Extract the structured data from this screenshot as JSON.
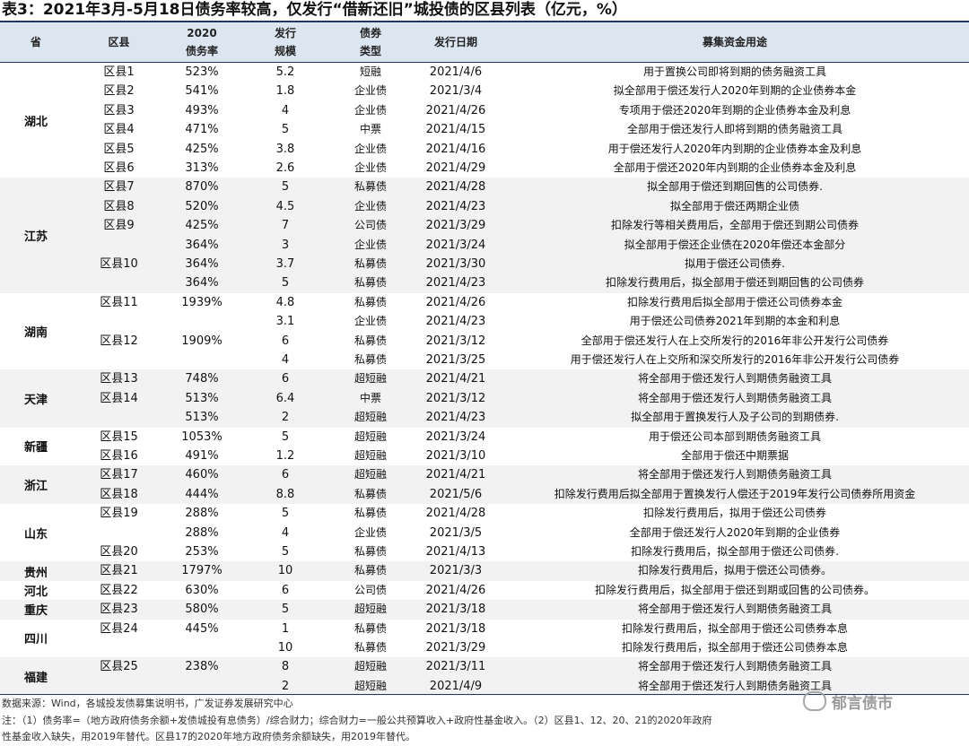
{
  "title": "表3：2021年3月-5月18日债务率较高，仅发行“借新还旧”城投债的区县列表（亿元，%）",
  "headers": {
    "province": "省",
    "county": "区县",
    "rate_1": "2020",
    "rate_2": "债务率",
    "scale_1": "发行",
    "scale_2": "规模",
    "type_1": "债券",
    "type_2": "类型",
    "date": "发行日期",
    "use": "募集资金用途"
  },
  "groups": [
    {
      "province": "湖北",
      "shade": false,
      "rows": [
        {
          "county": "区县1",
          "rate": "523%",
          "scale": "5.2",
          "type": "短融",
          "date": "2021/4/6",
          "use": "用于置换公司即将到期的债务融资工具"
        },
        {
          "county": "区县2",
          "rate": "541%",
          "scale": "1.8",
          "type": "企业债",
          "date": "2021/3/4",
          "use": "拟全部用于偿还发行人2020年到期的企业债券本金"
        },
        {
          "county": "区县3",
          "rate": "493%",
          "scale": "4",
          "type": "企业债",
          "date": "2021/4/26",
          "use": "专项用于偿还2020年到期的企业债券本金及利息"
        },
        {
          "county": "区县4",
          "rate": "471%",
          "scale": "5",
          "type": "中票",
          "date": "2021/4/15",
          "use": "全部用于偿还发行人即将到期的债务融资工具"
        },
        {
          "county": "区县5",
          "rate": "425%",
          "scale": "3.8",
          "type": "企业债",
          "date": "2021/4/16",
          "use": "用于偿还发行人2020年内到期的企业债券本金及利息"
        },
        {
          "county": "区县6",
          "rate": "313%",
          "scale": "2.6",
          "type": "企业债",
          "date": "2021/4/29",
          "use": "全部用于偿还2020年内到期的企业债券本金及利息"
        }
      ]
    },
    {
      "province": "江苏",
      "shade": true,
      "rows": [
        {
          "county": "区县7",
          "rate": "870%",
          "scale": "5",
          "type": "私募债",
          "date": "2021/4/28",
          "use": "拟全部用于偿还到期回售的公司债券."
        },
        {
          "county": "区县8",
          "rate": "520%",
          "scale": "4.5",
          "type": "企业债",
          "date": "2021/4/23",
          "use": "拟全部用于偿还两期企业债"
        },
        {
          "county": "区县9",
          "rate": "425%",
          "scale": "7",
          "type": "公司债",
          "date": "2021/3/29",
          "use": "扣除发行等相关费用后，全部用于偿还到期公司债券"
        },
        {
          "county": "",
          "rate": "364%",
          "scale": "3",
          "type": "企业债",
          "date": "2021/3/24",
          "use": "拟全部用于偿还企业债在2020年偿还本金部分"
        },
        {
          "county": "区县10",
          "rate": "364%",
          "scale": "3.7",
          "type": "私募债",
          "date": "2021/3/30",
          "use": "拟用于偿还公司债券."
        },
        {
          "county": "",
          "rate": "364%",
          "scale": "5",
          "type": "私募债",
          "date": "2021/4/23",
          "use": "扣除发行费用后，拟全部用于偿还到期回售的公司债券"
        }
      ]
    },
    {
      "province": "湖南",
      "shade": false,
      "rows": [
        {
          "county": "区县11",
          "rate": "1939%",
          "scale": "4.8",
          "type": "私募债",
          "date": "2021/4/26",
          "use": "扣除发行费用后拟全部用于偿还公司债券本金"
        },
        {
          "county": "",
          "rate": "",
          "scale": "3.1",
          "type": "企业债",
          "date": "2021/4/23",
          "use": "用于偿还公司债券2021年到期的本金和利息"
        },
        {
          "county": "区县12",
          "rate": "1909%",
          "scale": "6",
          "type": "私募债",
          "date": "2021/3/12",
          "use": "全部用于偿还发行人在上交所发行的2016年非公开发行公司债券"
        },
        {
          "county": "",
          "rate": "",
          "scale": "4",
          "type": "私募债",
          "date": "2021/3/25",
          "use": "用于偿还发行人在上交所和深交所发行的2016年非公开发行公司债券"
        }
      ]
    },
    {
      "province": "天津",
      "shade": true,
      "rows": [
        {
          "county": "区县13",
          "rate": "748%",
          "scale": "6",
          "type": "超短融",
          "date": "2021/4/21",
          "use": "将全部用于偿还发行人到期债务融资工具"
        },
        {
          "county": "区县14",
          "rate": "513%",
          "scale": "6.4",
          "type": "中票",
          "date": "2021/3/12",
          "use": "将全部用于偿还发行人到期债务融资工具"
        },
        {
          "county": "",
          "rate": "513%",
          "scale": "2",
          "type": "超短融",
          "date": "2021/4/23",
          "use": "拟全部用于置换发行人及子公司的到期债券."
        }
      ]
    },
    {
      "province": "新疆",
      "shade": false,
      "rows": [
        {
          "county": "区县15",
          "rate": "1053%",
          "scale": "5",
          "type": "超短融",
          "date": "2021/3/24",
          "use": "用于偿还公司本部到期债务融资工具"
        },
        {
          "county": "区县16",
          "rate": "491%",
          "scale": "1.2",
          "type": "超短融",
          "date": "2021/3/10",
          "use": "全部用于偿还中期票据"
        }
      ]
    },
    {
      "province": "浙江",
      "shade": true,
      "rows": [
        {
          "county": "区县17",
          "rate": "460%",
          "scale": "6",
          "type": "超短融",
          "date": "2021/4/21",
          "use": "将全部用于偿还发行人到期债务融资工具"
        },
        {
          "county": "区县18",
          "rate": "444%",
          "scale": "8.8",
          "type": "私募债",
          "date": "2021/5/6",
          "use": "扣除发行费用后拟全部用于置换发行人偿还于2019年发行公司债券所用资金"
        }
      ]
    },
    {
      "province": "山东",
      "shade": false,
      "rows": [
        {
          "county": "区县19",
          "rate": "288%",
          "scale": "5",
          "type": "私募债",
          "date": "2021/4/28",
          "use": "扣除发行费用后，拟用于偿还公司债券"
        },
        {
          "county": "",
          "rate": "288%",
          "scale": "4",
          "type": "企业债",
          "date": "2021/3/5",
          "use": "全部用于偿还发行人2020年到期的企业债券"
        },
        {
          "county": "区县20",
          "rate": "253%",
          "scale": "5",
          "type": "私募债",
          "date": "2021/4/13",
          "use": "扣除发行费用后，拟全部用于偿还公司债券."
        }
      ]
    },
    {
      "province": "贵州",
      "shade": true,
      "rows": [
        {
          "county": "区县21",
          "rate": "1797%",
          "scale": "10",
          "type": "私募债",
          "date": "2021/3/3",
          "use": "扣除发行费用后，拟用于偿还公司债券。"
        }
      ]
    },
    {
      "province": "河北",
      "shade": false,
      "rows": [
        {
          "county": "区县22",
          "rate": "630%",
          "scale": "6",
          "type": "公司债",
          "date": "2021/4/26",
          "use": "扣除发行费用后，拟全部用于偿还到期或回售的公司债券。"
        }
      ]
    },
    {
      "province": "重庆",
      "shade": true,
      "rows": [
        {
          "county": "区县23",
          "rate": "580%",
          "scale": "5",
          "type": "超短融",
          "date": "2021/3/18",
          "use": "将全部用于偿还发行人到期债务融资工具"
        }
      ]
    },
    {
      "province": "四川",
      "shade": false,
      "rows": [
        {
          "county": "区县24",
          "rate": "445%",
          "scale": "1",
          "type": "私募债",
          "date": "2021/3/18",
          "use": "扣除发行费用后，拟全部用于偿还公司债券本息"
        },
        {
          "county": "",
          "rate": "",
          "scale": "10",
          "type": "私募债",
          "date": "2021/3/29",
          "use": "扣除发行费用后，拟全部用于偿还公司债券本息"
        }
      ]
    },
    {
      "province": "福建",
      "shade": true,
      "rows": [
        {
          "county": "区县25",
          "rate": "238%",
          "scale": "8",
          "type": "超短融",
          "date": "2021/3/11",
          "use": "将全部用于偿还发行人到期债务融资工具"
        },
        {
          "county": "",
          "rate": "",
          "scale": "2",
          "type": "超短融",
          "date": "2021/4/9",
          "use": "将全部用于偿还发行人到期债务融资工具"
        }
      ]
    }
  ],
  "notes": {
    "source": "数据来源：Wind，各城投发债募集说明书，广发证券发展研究中心",
    "note_line1": "注：（1）债务率=（地方政府债务余额+发债城投有息债务）/综合财力；综合财力=一般公共预算收入+政府性基金收入。（2）区县1、12、20、21的2020年政府",
    "note_line2": "性基金收入缺失，用2019年替代。区县17的2020年地方政府债务余额缺失，用2019年替代。"
  },
  "watermark": "郁言债市"
}
